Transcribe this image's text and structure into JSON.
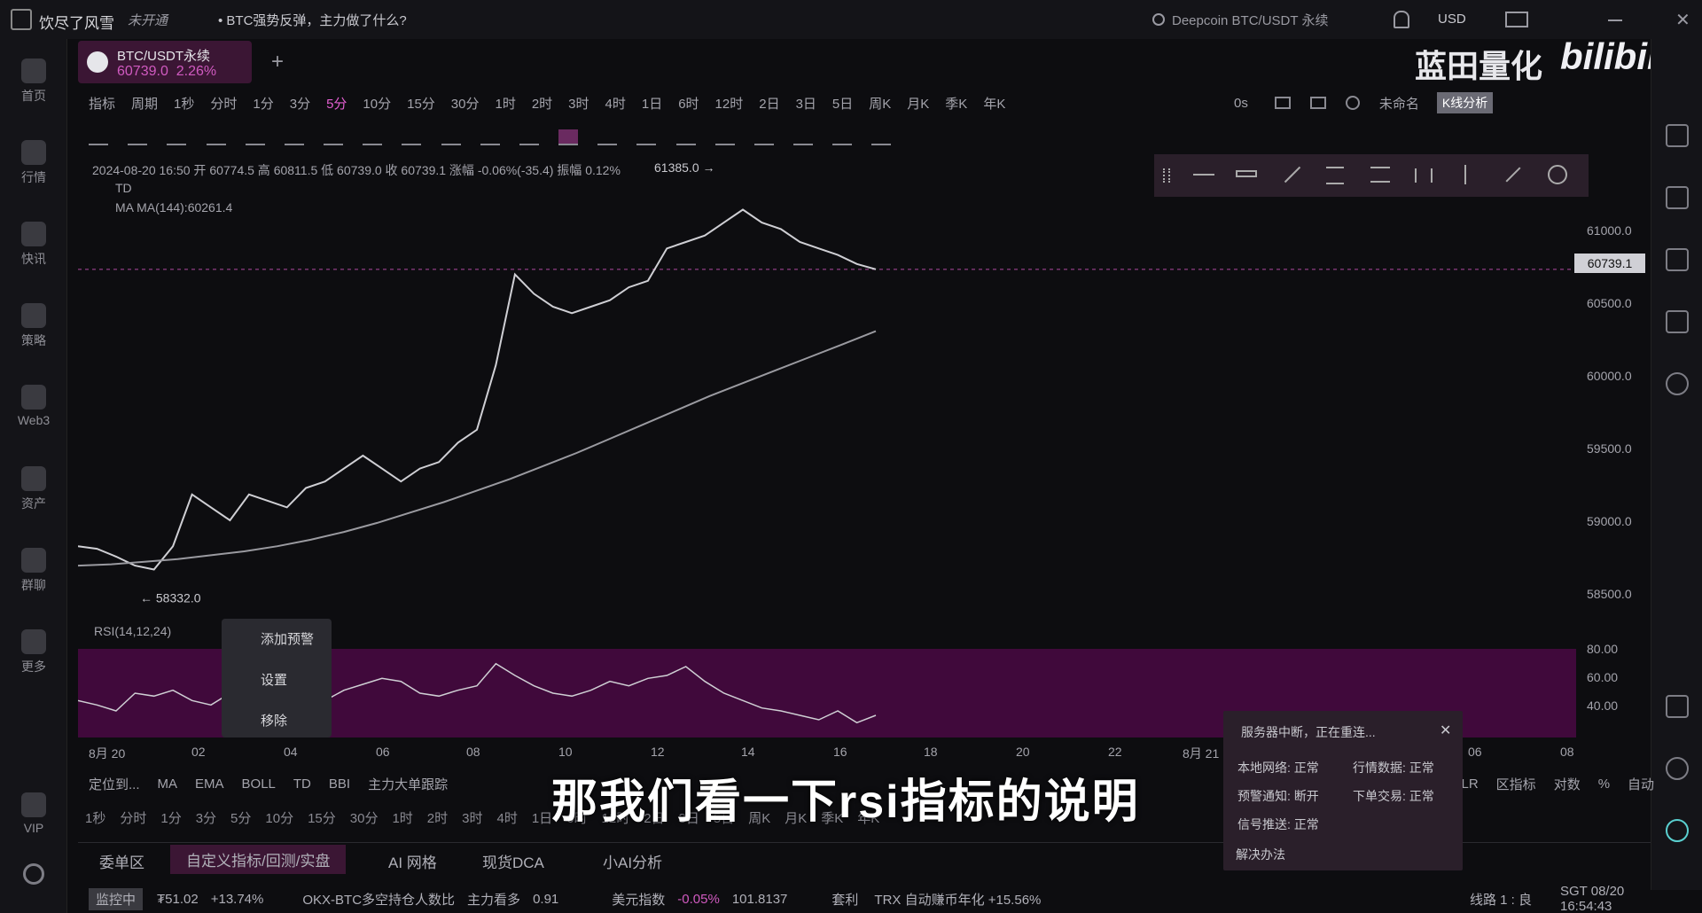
{
  "topbar": {
    "app_name": "饮尽了风雪",
    "badge": "未开通",
    "news": "• BTC强势反弹，主力做了什么?",
    "search": "Deepcoin BTC/USDT 永续",
    "currency": "USD"
  },
  "sidebar": {
    "items": [
      {
        "label": "首页",
        "icon": "home-icon"
      },
      {
        "label": "行情",
        "icon": "chart-icon"
      },
      {
        "label": "快讯",
        "icon": "news-icon"
      },
      {
        "label": "策略",
        "icon": "robot-icon"
      },
      {
        "label": "Web3",
        "icon": "web3-icon"
      },
      {
        "label": "资产",
        "icon": "wallet-icon"
      },
      {
        "label": "群聊",
        "icon": "chat-icon"
      },
      {
        "label": "更多",
        "icon": "grid-icon"
      },
      {
        "label": "VIP",
        "icon": "vip-icon"
      }
    ]
  },
  "tab": {
    "symbol": "BTC/USDT永续",
    "price": "60739.0",
    "change": "2.26%"
  },
  "timeframes": [
    "指标",
    "周期",
    "1秒",
    "分时",
    "1分",
    "3分",
    "5分",
    "10分",
    "15分",
    "30分",
    "1时",
    "2时",
    "3时",
    "4时",
    "1日",
    "6时",
    "12时",
    "2日",
    "3日",
    "5日",
    "周K",
    "月K",
    "季K",
    "年K"
  ],
  "active_timeframe": "5分",
  "toolbar_right": {
    "countdown": "0s",
    "layout": "未命名",
    "kline_analysis": "K线分析"
  },
  "legend": {
    "ohlc": "2024-08-20 16:50  开 60774.5  高 60811.5  低 60739.0  收 60739.1  涨幅 -0.06%(-35.4)  振幅 0.12%",
    "td": "TD",
    "ma": "MA    MA(144):60261.4"
  },
  "chart_data": {
    "type": "line",
    "price_ticks": [
      "61000.0",
      "60500.0",
      "60000.0",
      "59500.0",
      "59000.0",
      "58500.0"
    ],
    "last_price": "60739.1",
    "low_marker": "58332.0",
    "high_marker": "61385.0",
    "x_ticks": [
      "8月 20",
      "02",
      "04",
      "06",
      "08",
      "10",
      "12",
      "14",
      "16",
      "18",
      "20",
      "22",
      "8月 21",
      "06",
      "08"
    ],
    "close": [
      58600,
      58580,
      58520,
      58450,
      58420,
      58600,
      59000,
      58900,
      58800,
      59000,
      58950,
      58900,
      59050,
      59100,
      59200,
      59300,
      59200,
      59100,
      59200,
      59250,
      59400,
      59500,
      60000,
      60700,
      60550,
      60450,
      60400,
      60450,
      60500,
      60600,
      60650,
      60900,
      60950,
      61000,
      61100,
      61200,
      61100,
      61050,
      60950,
      60900,
      60850,
      60780,
      60739
    ],
    "ma": [
      58450,
      58460,
      58480,
      58500,
      58530,
      58560,
      58600,
      58650,
      58710,
      58780,
      58860,
      58940,
      59030,
      59120,
      59220,
      59320,
      59430,
      59540,
      59650,
      59760,
      59860,
      59960,
      60060,
      60160,
      60261
    ],
    "rsi_ticks": [
      "80.00",
      "60.00",
      "40.00"
    ],
    "rsi_label": "RSI(14,12,24)",
    "rsi": [
      55,
      52,
      48,
      60,
      58,
      62,
      55,
      52,
      60,
      58,
      62,
      65,
      58,
      55,
      62,
      66,
      70,
      68,
      60,
      58,
      62,
      65,
      80,
      72,
      65,
      60,
      58,
      62,
      68,
      65,
      70,
      72,
      78,
      68,
      60,
      55,
      50,
      48,
      45,
      42,
      48,
      40,
      45
    ]
  },
  "context_menu": [
    "添加预警",
    "设置",
    "移除"
  ],
  "indicators": [
    "定位到...",
    "MA",
    "EMA",
    "BOLL",
    "TD",
    "BBI",
    "主力大单跟踪"
  ],
  "indicators_right": [
    "MLR",
    "区指标",
    "对数",
    "%",
    "自动"
  ],
  "timeframes2": [
    "1秒",
    "分时",
    "1分",
    "3分",
    "5分",
    "10分",
    "15分",
    "30分",
    "1时",
    "2时",
    "3时",
    "4时",
    "1日",
    "6时",
    "12时",
    "2日",
    "3日",
    "5日",
    "周K",
    "月K",
    "季K",
    "年K"
  ],
  "bottom_tabs": [
    "委单区",
    "自定义指标/回测/实盘",
    "AI 网格",
    "现货DCA",
    "小AI分析"
  ],
  "status": {
    "monitor": "监控中",
    "price": "₮51.02",
    "change": "+13.74%",
    "item1": "OKX-BTC多空持仓人数比",
    "item1_label": "主力看多",
    "item1_val": "0.91",
    "item2": "美元指数",
    "item2_change": "-0.05%",
    "item2_val": "101.8137",
    "item3": "套利",
    "item3_text": "TRX 自动赚币年化 +15.56%",
    "line": "线路 1 : 良",
    "time": "SGT 08/20 16:54:43"
  },
  "notification": {
    "title": "服务器中断，正在重连...",
    "rows": [
      [
        "本地网络: 正常",
        "行情数据: 正常"
      ],
      [
        "预警通知: 断开",
        "下单交易: 正常"
      ],
      [
        "信号推送: 正常",
        ""
      ]
    ],
    "fix": "解决办法"
  },
  "subtitle": "那我们看一下rsi指标的说明",
  "watermark": "蓝田量化",
  "bili": "bilibili"
}
